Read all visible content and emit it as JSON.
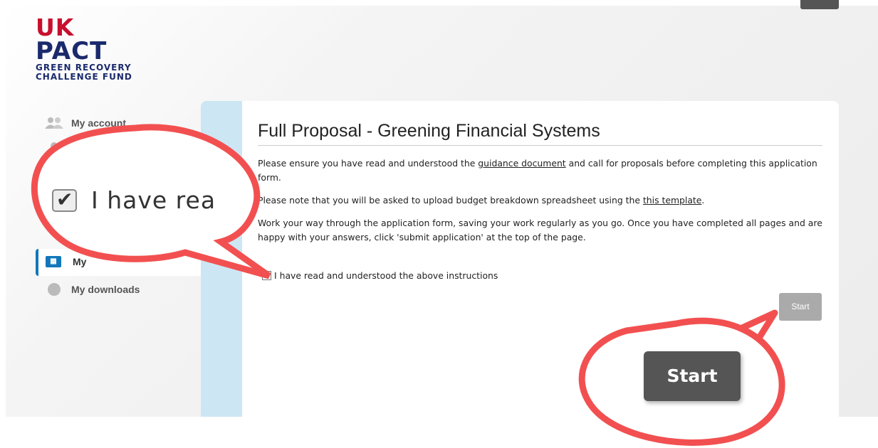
{
  "logo": {
    "line1_uk": "UK",
    "line2": "PACT",
    "line3": "GREEN RECOVERY",
    "line4": "CHALLENGE FUND"
  },
  "sidebar": {
    "items": [
      {
        "label": "My account",
        "icon": "users-icon"
      },
      {
        "label": "",
        "icon": "user-icon"
      },
      {
        "label": "My",
        "icon": "applications-icon"
      },
      {
        "label": "My downloads",
        "icon": "download-icon"
      }
    ]
  },
  "main": {
    "title": "Full Proposal - Greening Financial Systems",
    "para1_before": "Please ensure you have read and understood the ",
    "para1_link": "guidance document",
    "para1_after": " and call for proposals before completing this application form.",
    "para2_before": "Please note that you will be asked to upload budget breakdown spreadsheet using the ",
    "para2_link": "this template",
    "para2_after": ".",
    "para3": "Work your way through the application form, saving your work regularly as you go. Once you have completed all pages and are happy with your answers, click 'submit application' at the top of the page.",
    "checkbox_label": "I have read and understood the above instructions",
    "start_label": "Start"
  },
  "callouts": {
    "checkbox_zoom_text": "I have rea",
    "start_zoom_text": "Start",
    "color": "#f25050"
  }
}
